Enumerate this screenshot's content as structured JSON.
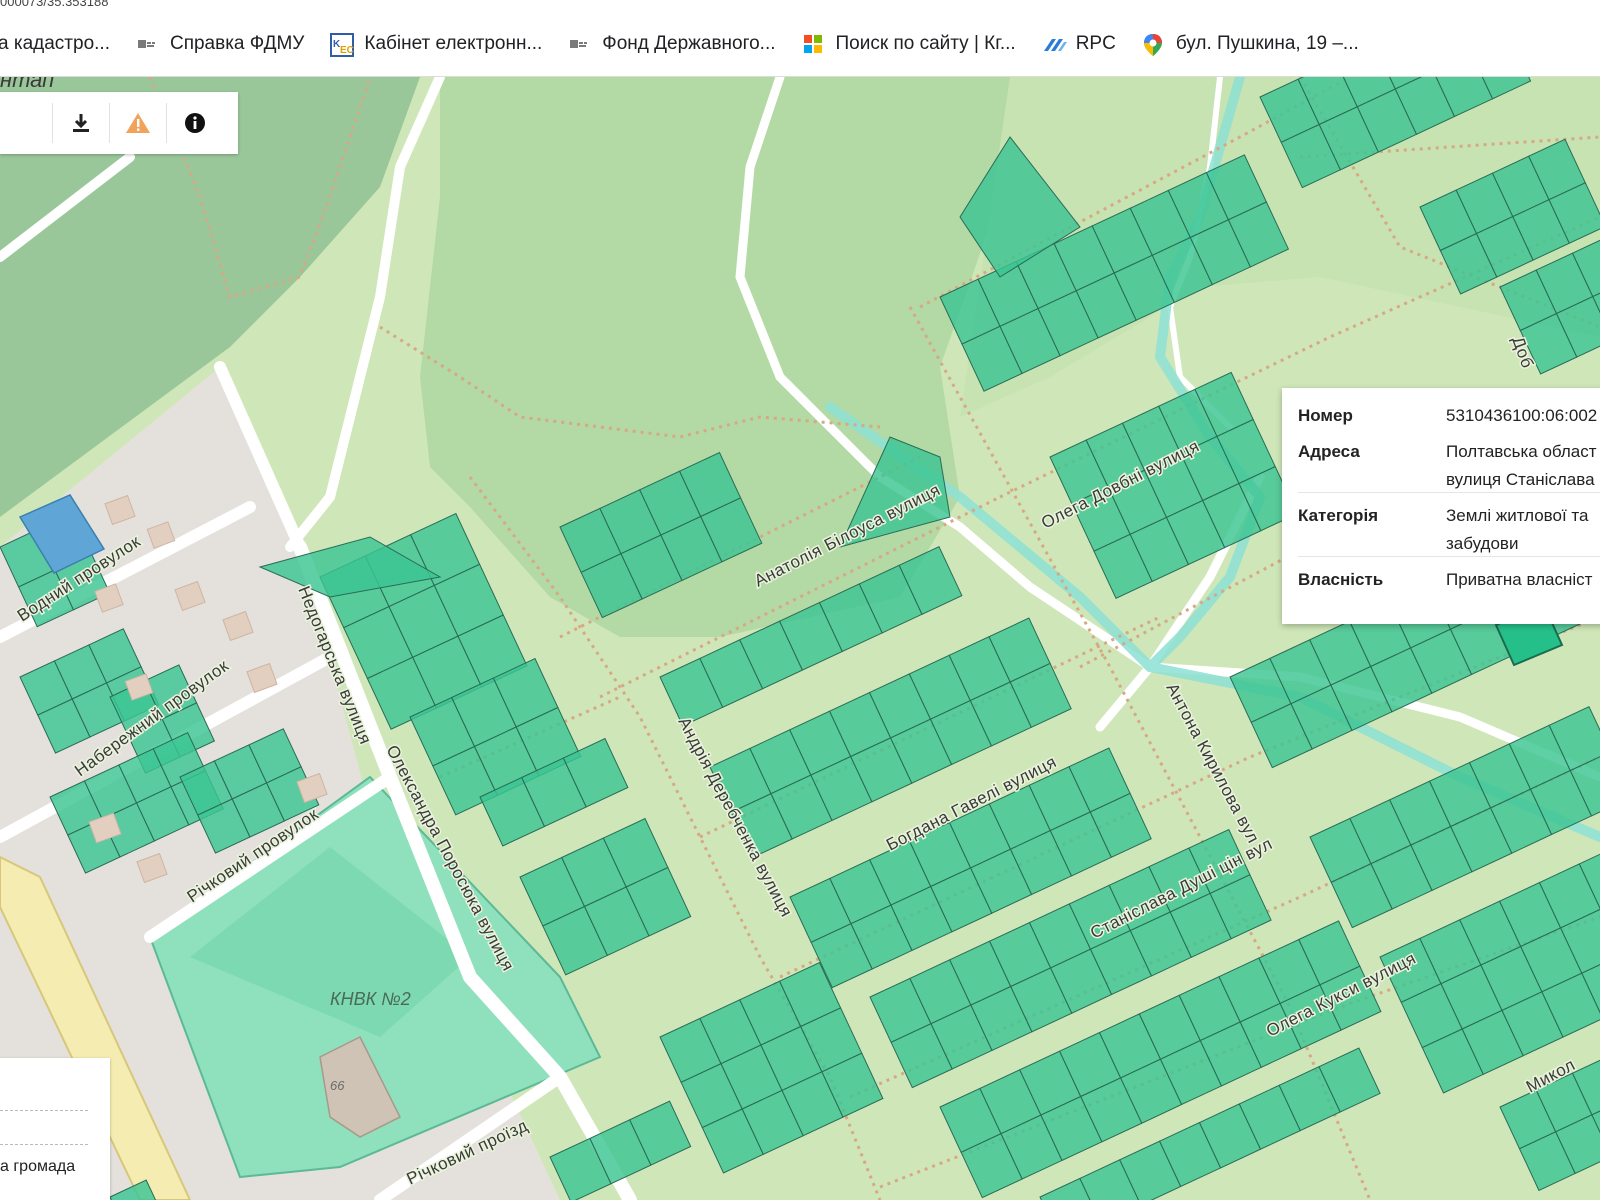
{
  "browser": {
    "url_fragment": "000073/35.353188",
    "bookmarks": [
      {
        "icon": "cadastre-icon",
        "label": "а кадастро..."
      },
      {
        "icon": "fdmu-icon",
        "label": "Справка ФДМУ"
      },
      {
        "icon": "kes-icon",
        "label": "Кабінет електронн..."
      },
      {
        "icon": "fdmu-icon",
        "label": "Фонд Державного..."
      },
      {
        "icon": "windows-grid-icon",
        "label": "Поиск по сайту | Кг..."
      },
      {
        "icon": "rpc-icon",
        "label": "RPC"
      },
      {
        "icon": "map-pin-icon",
        "label": "бул. Пушкина, 19 –..."
      }
    ]
  },
  "toolbar": {
    "buttons": [
      {
        "icon": "download-icon"
      },
      {
        "icon": "warning-icon"
      },
      {
        "icon": "info-icon"
      }
    ]
  },
  "map": {
    "top_label_fragment": "нтап",
    "streets": [
      "Водний провулок",
      "Набережний провулок",
      "Річковий провулок",
      "Недогарська вулиця",
      "Олександра Поросюка вулиця",
      "Анатолія Білоуса вулиця",
      "Олега Довбні вулиця",
      "Андрія Деребченка вулиця",
      "Богдана Гавелі вулиця",
      "Антона Кирилова вул",
      "Станіслава Душі цін вул",
      "Олега Кукси вулиця",
      "Річковий проїзд",
      "Доб",
      "Микол"
    ],
    "poi": "КНВК №2",
    "building_number": "66"
  },
  "popup": {
    "rows": [
      {
        "key": "Номер",
        "value": "5310436100:06:002"
      },
      {
        "key": "Адреса",
        "value": "Полтавська област",
        "value2": "вулиця Станіслава"
      },
      {
        "key": "Категорія",
        "value": "Землі житлової та",
        "value2": "забудови"
      },
      {
        "key": "Власність",
        "value": "Приватна власніст"
      }
    ]
  },
  "legend": {
    "label": "а громада"
  },
  "colors": {
    "parcel": "#3cc492",
    "parcel_edge": "#2a6b55",
    "forest": "#a8d4a0",
    "meadow": "#cfe7b8",
    "road": "#ffffff"
  }
}
